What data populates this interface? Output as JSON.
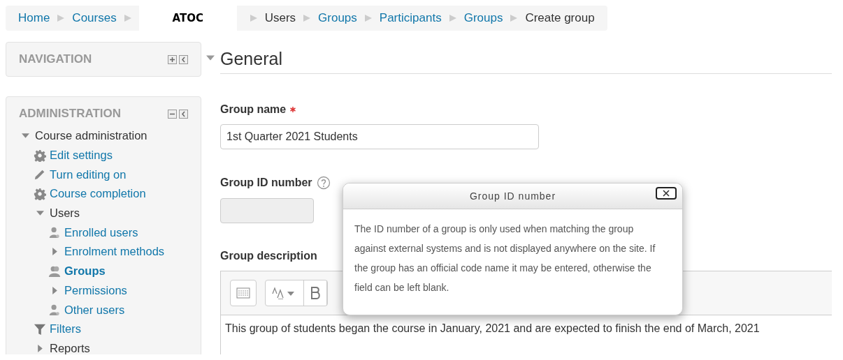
{
  "breadcrumb": [
    {
      "label": "Home",
      "kind": "link"
    },
    {
      "label": "Courses",
      "kind": "link"
    },
    {
      "label": "ATOC",
      "kind": "label"
    },
    {
      "label": "Users",
      "kind": "text"
    },
    {
      "label": "Groups",
      "kind": "link"
    },
    {
      "label": "Participants",
      "kind": "link"
    },
    {
      "label": "Groups",
      "kind": "link"
    },
    {
      "label": "Create group",
      "kind": "text"
    }
  ],
  "blocks": [
    {
      "title": "NAVIGATION",
      "expanded": false
    },
    {
      "title": "ADMINISTRATION",
      "expanded": true,
      "tree": [
        {
          "label": "Course administration",
          "kind": "branch",
          "link": false,
          "expanded": true,
          "selected": false,
          "children": [
            {
              "label": "Edit settings",
              "kind": "settings",
              "link": true,
              "selected": false
            },
            {
              "label": "Turn editing on",
              "kind": "edit",
              "link": true,
              "selected": false
            },
            {
              "label": "Course completion",
              "kind": "settings",
              "link": true,
              "selected": false
            },
            {
              "label": "Users",
              "kind": "branch",
              "link": false,
              "expanded": true,
              "selected": false,
              "children": [
                {
                  "label": "Enrolled users",
                  "kind": "user",
                  "link": true,
                  "selected": false
                },
                {
                  "label": "Enrolment methods",
                  "kind": "branch",
                  "link": true,
                  "expanded": false,
                  "selected": false
                },
                {
                  "label": "Groups",
                  "kind": "group",
                  "link": true,
                  "selected": true
                },
                {
                  "label": "Permissions",
                  "kind": "branch",
                  "link": true,
                  "expanded": false,
                  "selected": false
                },
                {
                  "label": "Other users",
                  "kind": "user",
                  "link": true,
                  "selected": false
                }
              ]
            },
            {
              "label": "Filters",
              "kind": "filter",
              "link": true,
              "selected": false
            },
            {
              "label": "Reports",
              "kind": "branch",
              "link": false,
              "expanded": false,
              "selected": false
            }
          ]
        }
      ]
    }
  ],
  "section": {
    "title": "General",
    "expanded": true,
    "fields": [
      {
        "kind": "text",
        "label": "Group name",
        "required": true,
        "help": false,
        "disabled": false,
        "value": "1st Quarter 2021 Students"
      },
      {
        "kind": "text",
        "label": "Group ID number",
        "required": false,
        "help": true,
        "disabled": true
      },
      {
        "kind": "editor",
        "label": "Group description",
        "required": false,
        "help": false,
        "disabled": false,
        "value": "This group of students began the course in January, 2021 and are expected to finish the end of March, 2021"
      }
    ]
  },
  "popup": {
    "title": "Group ID number",
    "text": "The ID number of a group is only used when matching the group against external systems and is not displayed anywhere on the site. If the group has an official code name it may be entered, otherwise the field can be left blank."
  }
}
